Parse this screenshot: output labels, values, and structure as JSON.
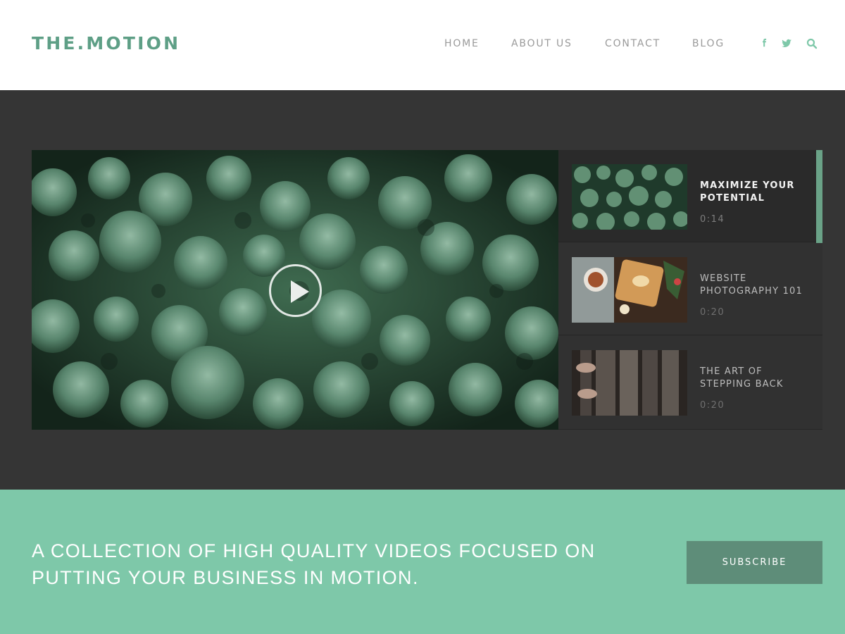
{
  "header": {
    "logo": "THE.MOTION",
    "nav": [
      "HOME",
      "ABOUT US",
      "CONTACT",
      "BLOG"
    ],
    "social_icons": [
      "facebook-icon",
      "twitter-icon",
      "search-icon"
    ],
    "accent_color": "#5e9f86"
  },
  "player": {
    "play_icon": "play-icon"
  },
  "playlist": [
    {
      "title": "MAXIMIZE YOUR POTENTIAL",
      "duration": "0:14",
      "active": true
    },
    {
      "title": "WEBSITE PHOTOGRAPHY 101",
      "duration": "0:20",
      "active": false
    },
    {
      "title": "THE ART OF STEPPING BACK",
      "duration": "0:20",
      "active": false
    }
  ],
  "cta": {
    "text": "A COLLECTION OF HIGH QUALITY VIDEOS FOCUSED ON PUTTING YOUR BUSINESS IN MOTION.",
    "button": "SUBSCRIBE",
    "background": "#7ec8a9"
  }
}
